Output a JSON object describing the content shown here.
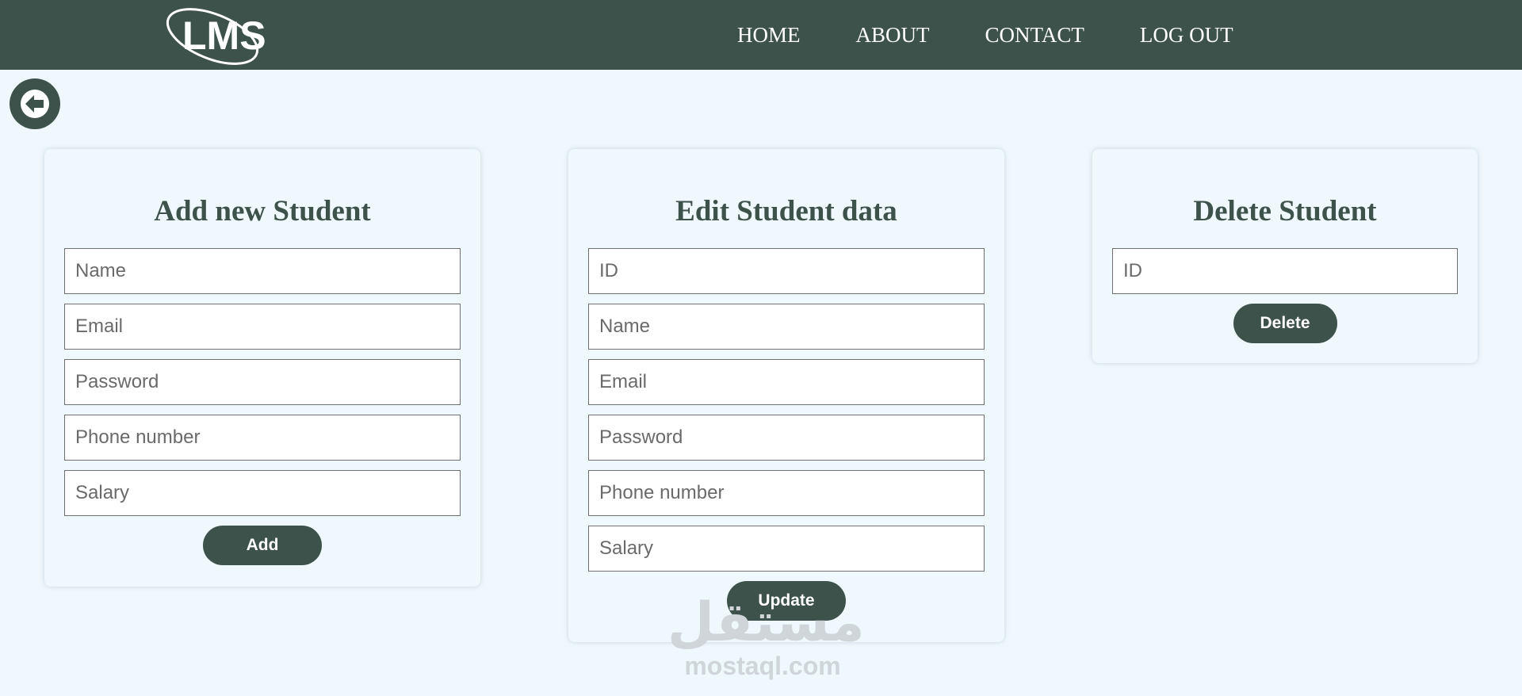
{
  "header": {
    "logo_text": "LMS",
    "nav": [
      {
        "label": "HOME"
      },
      {
        "label": "ABOUT"
      },
      {
        "label": "CONTACT"
      },
      {
        "label": "LOG OUT"
      }
    ]
  },
  "back_button": {
    "icon": "arrow-left-icon"
  },
  "add_card": {
    "title": "Add new Student",
    "placeholders": [
      "Name",
      "Email",
      "Password",
      "Phone number",
      "Salary"
    ],
    "button_label": "Add"
  },
  "edit_card": {
    "title": "Edit Student data",
    "placeholders": [
      "ID",
      "Name",
      "Email",
      "Password",
      "Phone number",
      "Salary"
    ],
    "button_label": "Update"
  },
  "delete_card": {
    "title": "Delete Student",
    "placeholders": [
      "ID"
    ],
    "button_label": "Delete"
  },
  "watermark": {
    "arabic": "مستقل",
    "latin": "mostaql.com"
  },
  "colors": {
    "primary": "#3c524a",
    "background": "#eff8fc",
    "white": "#ffffff"
  }
}
